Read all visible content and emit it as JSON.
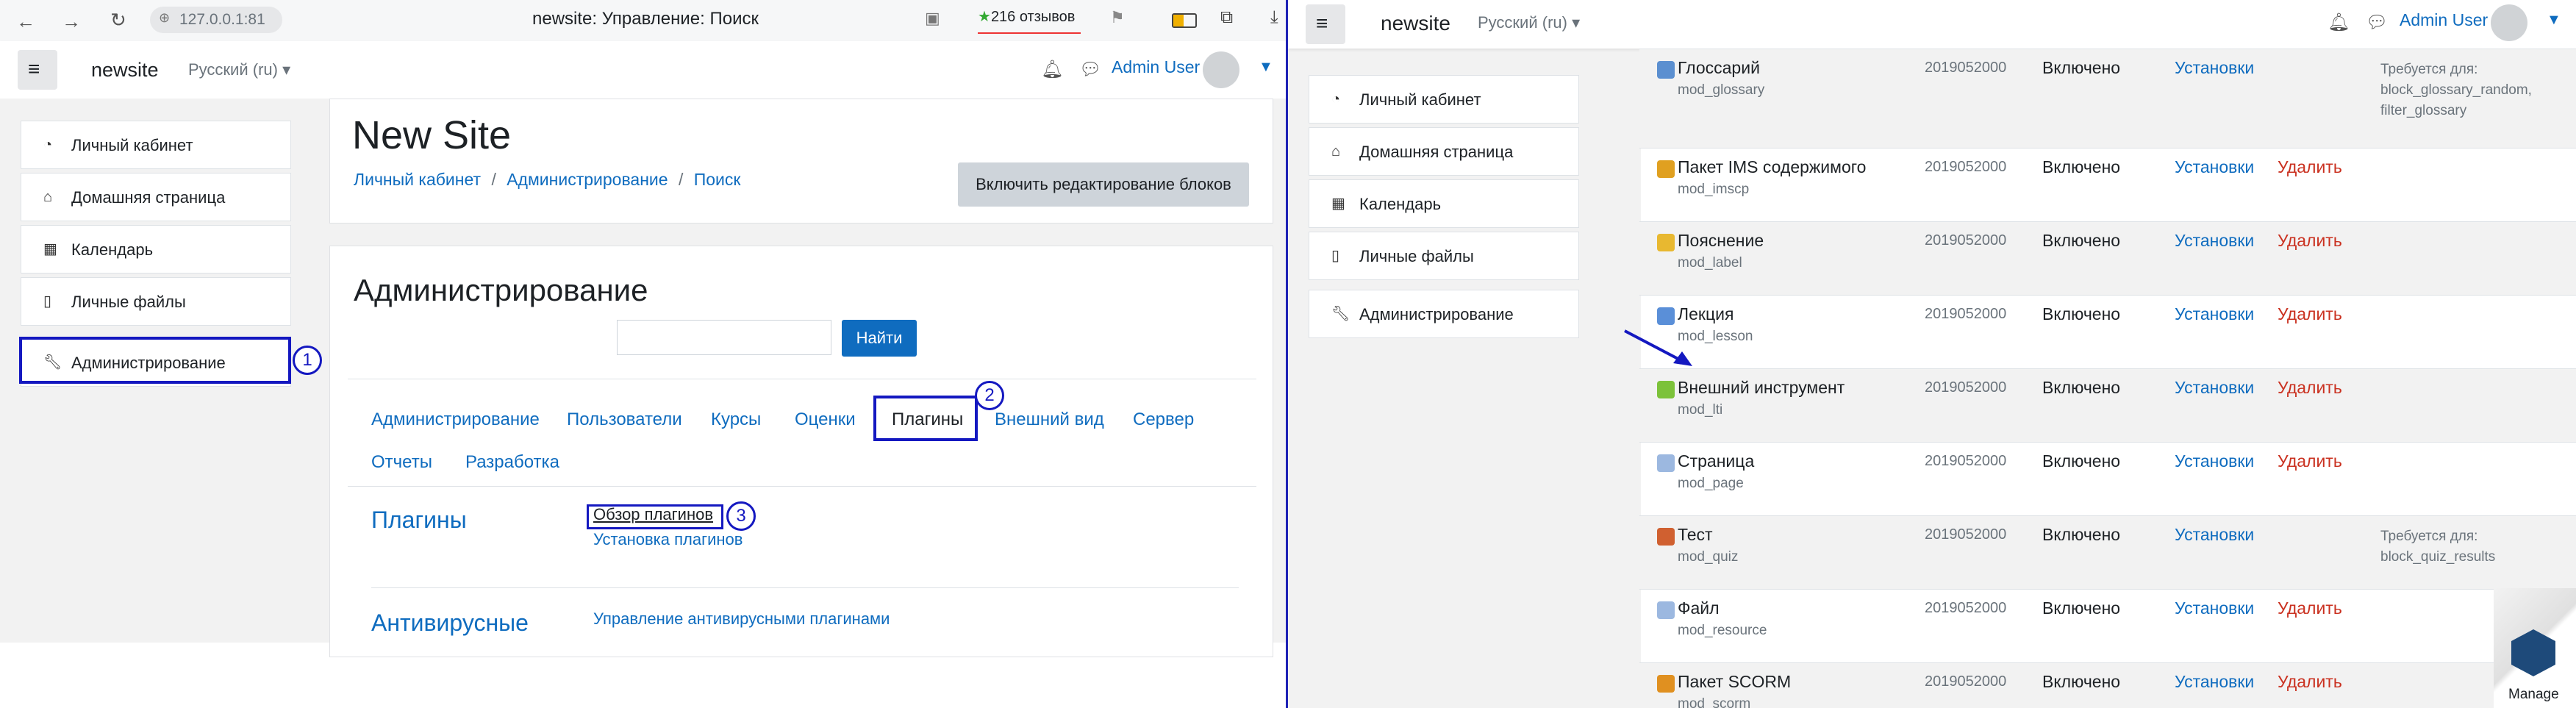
{
  "left": {
    "browser": {
      "url": "127.0.0.1:81",
      "title": "newsite: Управление: Поиск",
      "reviews": "216 отзывов"
    },
    "navbar": {
      "site_name": "newsite",
      "language": "Русский (ru)",
      "user_name": "Admin User"
    },
    "nav": {
      "items": [
        "Личный кабинет",
        "Домашняя страница",
        "Календарь",
        "Личные файлы"
      ],
      "admin": "Администрирование"
    },
    "header": {
      "site_title": "New Site",
      "breadcrumb": [
        "Личный кабинет",
        "Администрирование",
        "Поиск"
      ],
      "breadcrumb_sep": "/",
      "edit_button": "Включить редактирование блоков"
    },
    "admin": {
      "title": "Администрирование",
      "search_value": "",
      "search_button": "Найти",
      "tabs": [
        "Администрирование",
        "Пользователи",
        "Курсы",
        "Оценки",
        "Плагины",
        "Внешний вид",
        "Сервер",
        "Отчеты",
        "Разработка"
      ],
      "plugins_heading": "Плагины",
      "plugins_links": [
        "Обзор плагинов",
        "Установка плагинов"
      ],
      "antivirus_heading": "Антивирусные",
      "antivirus_link": "Управление антивирусными плагинами"
    },
    "markers": [
      "1",
      "2",
      "3"
    ]
  },
  "right": {
    "navbar": {
      "site_name": "newsite",
      "language": "Русский (ru)",
      "user_name": "Admin User"
    },
    "nav": {
      "items": [
        "Личный кабинет",
        "Домашняя страница",
        "Календарь",
        "Личные файлы"
      ],
      "admin": "Администрирование"
    },
    "plugins": [
      {
        "name": "Глоссарий",
        "component": "mod_glossary",
        "version": "2019052000",
        "status": "Включено",
        "settings": "Установки",
        "delete": "",
        "requires": [
          "Требуется для:",
          "block_glossary_random,",
          "filter_glossary"
        ],
        "icon_color": "#5b8fd0"
      },
      {
        "name": "Пакет IMS содержимого",
        "component": "mod_imscp",
        "version": "2019052000",
        "status": "Включено",
        "settings": "Установки",
        "delete": "Удалить",
        "requires": [],
        "icon_color": "#e0a020"
      },
      {
        "name": "Пояснение",
        "component": "mod_label",
        "version": "2019052000",
        "status": "Включено",
        "settings": "Установки",
        "delete": "Удалить",
        "requires": [],
        "icon_color": "#e8b830"
      },
      {
        "name": "Лекция",
        "component": "mod_lesson",
        "version": "2019052000",
        "status": "Включено",
        "settings": "Установки",
        "delete": "Удалить",
        "requires": [],
        "icon_color": "#5a8fd8"
      },
      {
        "name": "Внешний инструмент",
        "component": "mod_lti",
        "version": "2019052000",
        "status": "Включено",
        "settings": "Установки",
        "delete": "Удалить",
        "requires": [],
        "icon_color": "#7cc23a"
      },
      {
        "name": "Страница",
        "component": "mod_page",
        "version": "2019052000",
        "status": "Включено",
        "settings": "Установки",
        "delete": "Удалить",
        "requires": [],
        "icon_color": "#9cb8e0"
      },
      {
        "name": "Тест",
        "component": "mod_quiz",
        "version": "2019052000",
        "status": "Включено",
        "settings": "Установки",
        "delete": "",
        "requires": [
          "Требуется для:",
          "block_quiz_results"
        ],
        "icon_color": "#d06030"
      },
      {
        "name": "Файл",
        "component": "mod_resource",
        "version": "2019052000",
        "status": "Включено",
        "settings": "Установки",
        "delete": "Удалить",
        "requires": [],
        "icon_color": "#9cb8e0"
      },
      {
        "name": "Пакет SCORM",
        "component": "mod_scorm",
        "version": "2019052000",
        "status": "Включено",
        "settings": "Установки",
        "delete": "Удалить",
        "requires": [],
        "icon_color": "#e09020"
      }
    ],
    "manage_label": "Manage"
  },
  "colors": {
    "link": "#0f6cbf",
    "danger": "#ca3120",
    "primary_button": "#0f6cbf",
    "highlight": "#1418c0"
  }
}
